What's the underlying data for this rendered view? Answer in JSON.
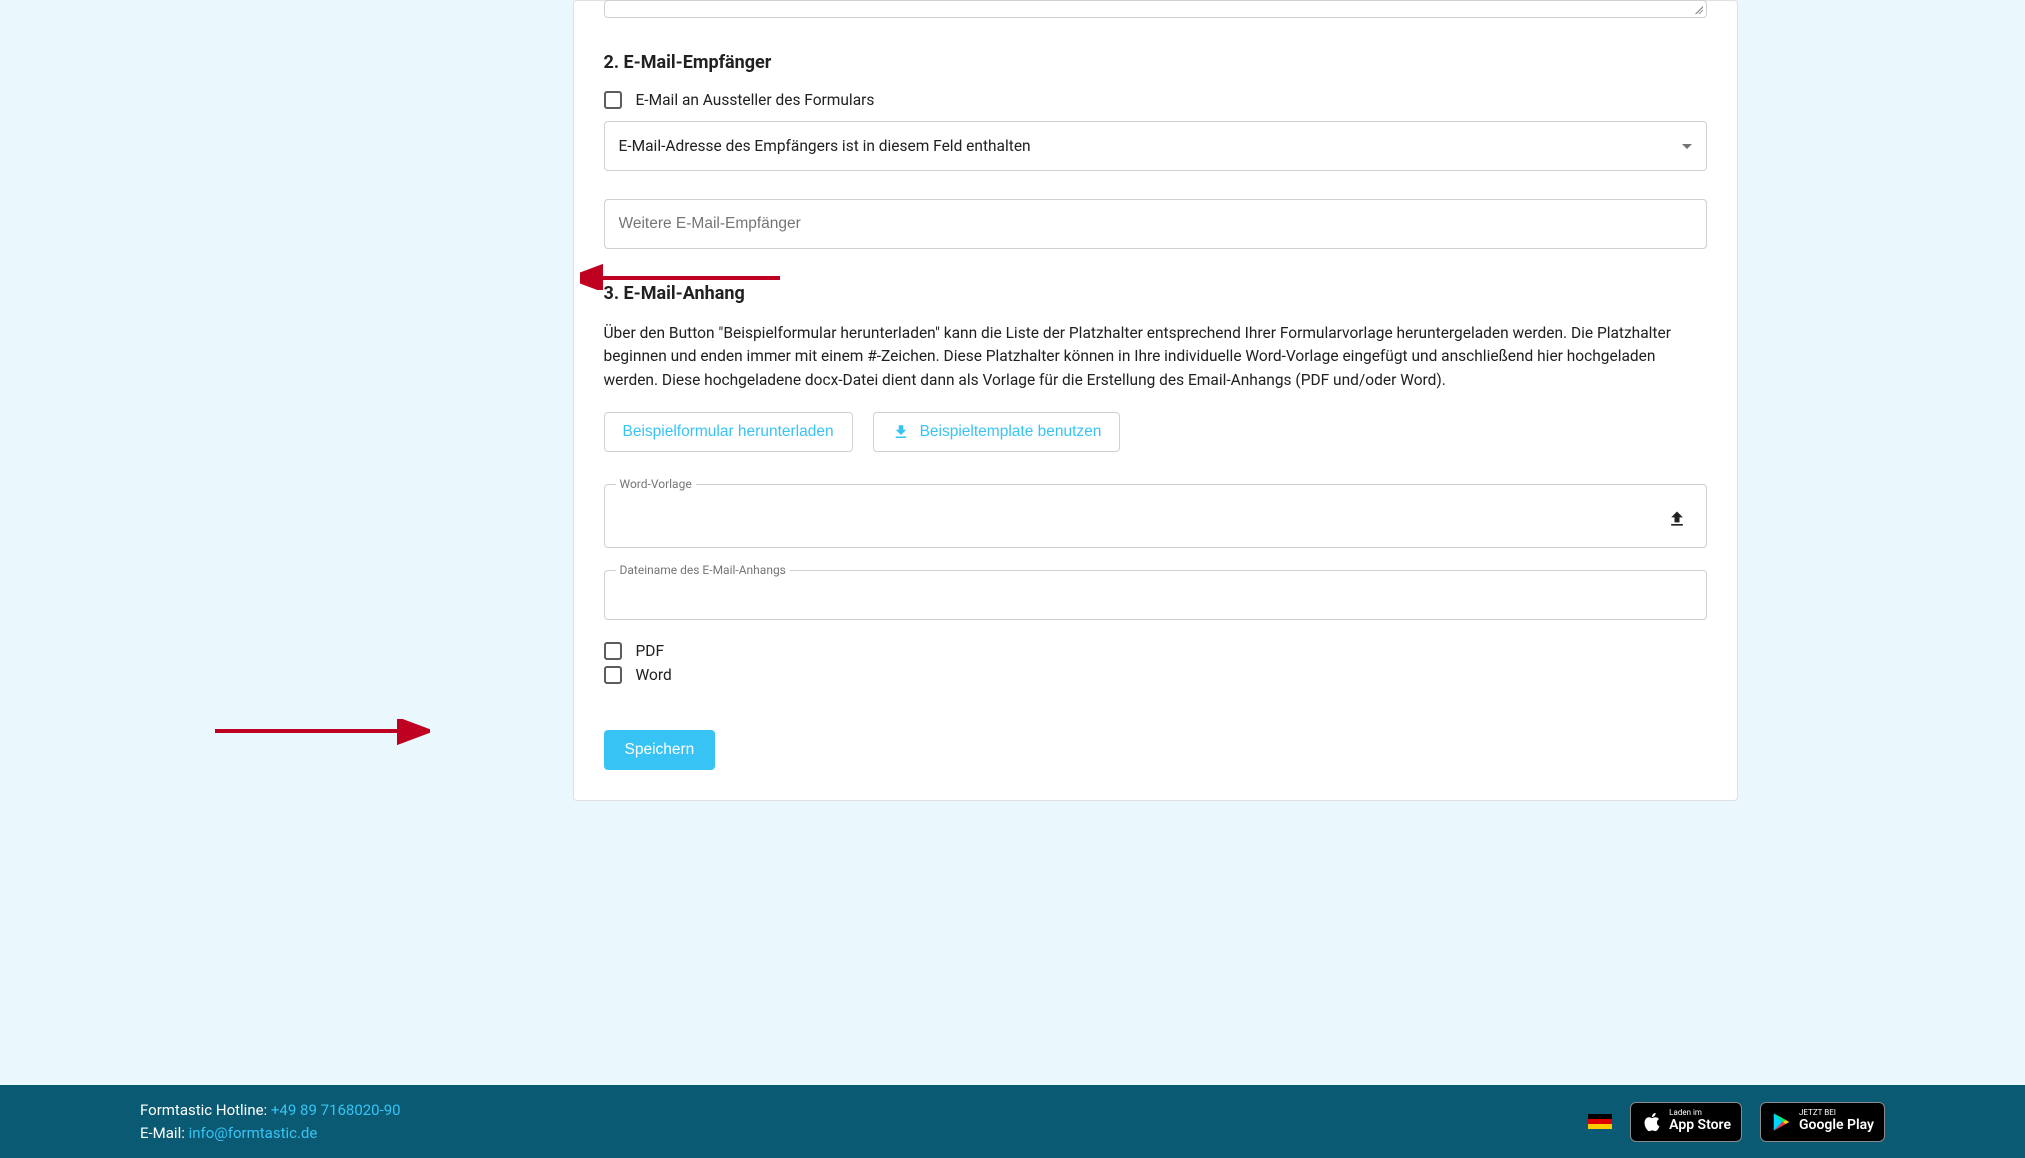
{
  "section2": {
    "heading": "2. E-Mail-Empfänger",
    "checkbox_label": "E-Mail an Aussteller des Formulars",
    "select_text": "E-Mail-Adresse des Empfängers ist in diesem Feld enthalten",
    "additional_placeholder": "Weitere E-Mail-Empfänger"
  },
  "section3": {
    "heading": "3. E-Mail-Anhang",
    "description": "Über den Button \"Beispielformular herunterladen\" kann die Liste der Platzhalter entsprechend Ihrer Formularvorlage heruntergeladen werden. Die Platzhalter beginnen und enden immer mit einem #-Zeichen. Diese Platzhalter können in Ihre individuelle Word-Vorlage eingefügt und anschließend hier hochgeladen werden. Diese hochgeladene docx-Datei dient dann als Vorlage für die Erstellung des Email-Anhangs (PDF und/oder Word).",
    "button_download": "Beispielformular herunterladen",
    "button_template": "Beispieltemplate benutzen",
    "word_template_label": "Word-Vorlage",
    "filename_label": "Dateiname des E-Mail-Anhangs",
    "checkbox_pdf": "PDF",
    "checkbox_word": "Word"
  },
  "save_button": "Speichern",
  "footer": {
    "hotline_label": "Formtastic Hotline: ",
    "hotline_number": "+49 89 7168020-90",
    "email_label": "E-Mail: ",
    "email_value": "info@formtastic.de",
    "appstore_small": "Laden im",
    "appstore_large": "App Store",
    "playstore_small": "JETZT BEI",
    "playstore_large": "Google Play"
  }
}
